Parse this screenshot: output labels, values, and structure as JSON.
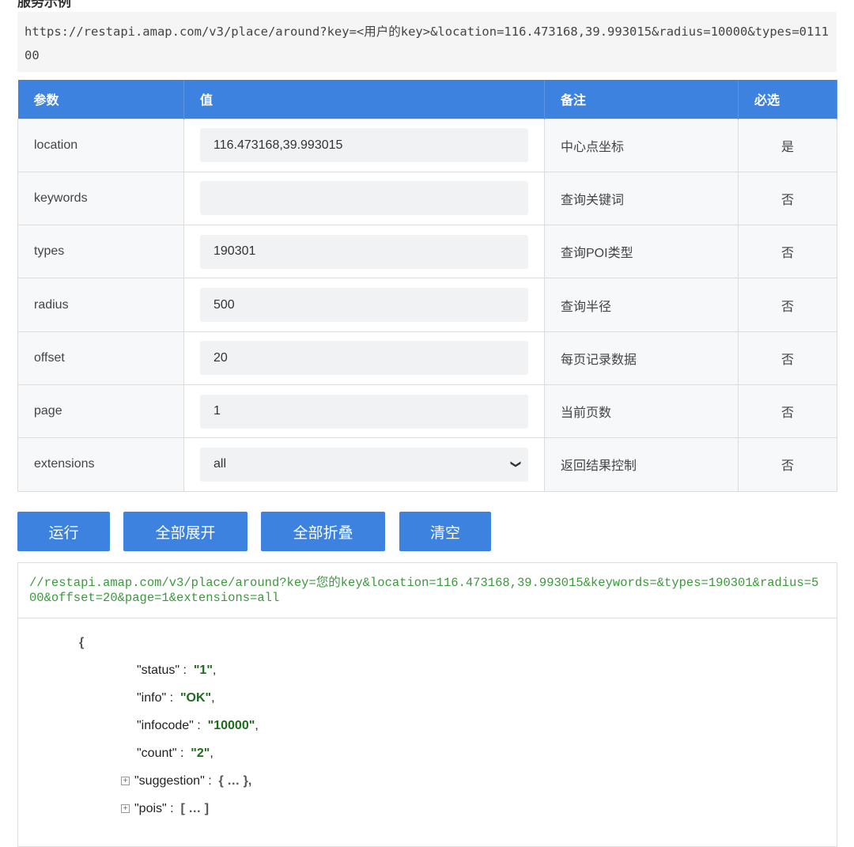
{
  "section_title": "服务示例",
  "example_url": "https://restapi.amap.com/v3/place/around?key=<用户的key>&location=116.473168,39.993015&radius=10000&types=011100",
  "table": {
    "headers": [
      "参数",
      "值",
      "备注",
      "必选"
    ],
    "rows": [
      {
        "param": "location",
        "value": "116.473168,39.993015",
        "note": "中心点坐标",
        "required": "是"
      },
      {
        "param": "keywords",
        "value": "",
        "note": "查询关键词",
        "required": "否"
      },
      {
        "param": "types",
        "value": "190301",
        "note": "查询POI类型",
        "required": "否"
      },
      {
        "param": "radius",
        "value": "500",
        "note": "查询半径",
        "required": "否"
      },
      {
        "param": "offset",
        "value": "20",
        "note": "每页记录数据",
        "required": "否"
      },
      {
        "param": "page",
        "value": "1",
        "note": "当前页数",
        "required": "否"
      },
      {
        "param": "extensions",
        "value": "all",
        "note": "返回结果控制",
        "required": "否"
      }
    ]
  },
  "buttons": {
    "run": "运行",
    "expand": "全部展开",
    "collapse": "全部折叠",
    "clear": "清空"
  },
  "result": {
    "url": "//restapi.amap.com/v3/place/around?key=您的key&location=116.473168,39.993015&keywords=&types=190301&radius=500&offset=20&page=1&extensions=all",
    "open_brace": "{",
    "fields": [
      {
        "key": "\"status\"",
        "value": "\"1\""
      },
      {
        "key": "\"info\"",
        "value": "\"OK\""
      },
      {
        "key": "\"infocode\"",
        "value": "\"10000\""
      },
      {
        "key": "\"count\"",
        "value": "\"2\""
      }
    ],
    "suggestion": {
      "key": "\"suggestion\"",
      "value": "{ … },"
    },
    "pois": {
      "key": "\"pois\"",
      "value": "[ … ]"
    }
  }
}
